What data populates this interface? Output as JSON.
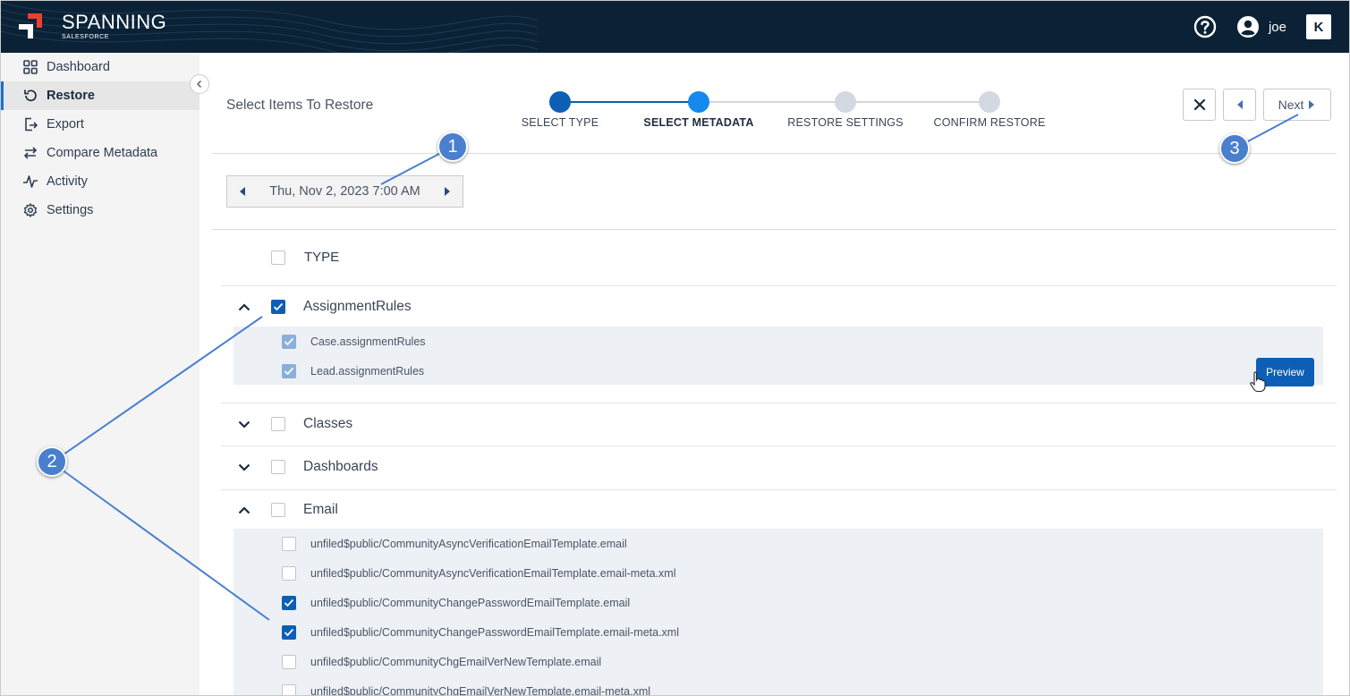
{
  "header": {
    "brand_title": "SPANNING",
    "brand_sub": "SALESFORCE",
    "user": "joe",
    "vendor_logo": "K",
    "colors": {
      "bar": "#0b2236",
      "accent": "#e8412f"
    }
  },
  "sidebar": {
    "items": [
      {
        "label": "Dashboard",
        "icon": "grid-icon"
      },
      {
        "label": "Restore",
        "icon": "restore-icon",
        "active": true
      },
      {
        "label": "Export",
        "icon": "export-icon"
      },
      {
        "label": "Compare Metadata",
        "icon": "compare-icon"
      },
      {
        "label": "Activity",
        "icon": "activity-icon"
      },
      {
        "label": "Settings",
        "icon": "gear-icon"
      }
    ]
  },
  "main": {
    "title": "Select Items To Restore",
    "steps": [
      {
        "label": "SELECT TYPE",
        "state": "done"
      },
      {
        "label": "SELECT METADATA",
        "state": "current"
      },
      {
        "label": "RESTORE SETTINGS",
        "state": "todo"
      },
      {
        "label": "CONFIRM RESTORE",
        "state": "todo"
      }
    ],
    "next_label": "Next",
    "date": "Thu, Nov 2, 2023 7:00 AM",
    "type_header": "TYPE",
    "groups": [
      {
        "name": "AssignmentRules",
        "expanded": true,
        "checked": true,
        "items": [
          {
            "name": "Case.assignmentRules",
            "checked": true
          },
          {
            "name": "Lead.assignmentRules",
            "checked": true
          }
        ],
        "preview_label": "Preview"
      },
      {
        "name": "Classes",
        "expanded": false,
        "checked": false
      },
      {
        "name": "Dashboards",
        "expanded": false,
        "checked": false
      },
      {
        "name": "Email",
        "expanded": true,
        "checked": false,
        "items": [
          {
            "name": "unfiled$public/CommunityAsyncVerificationEmailTemplate.email",
            "checked": false
          },
          {
            "name": "unfiled$public/CommunityAsyncVerificationEmailTemplate.email-meta.xml",
            "checked": false
          },
          {
            "name": "unfiled$public/CommunityChangePasswordEmailTemplate.email",
            "checked": true
          },
          {
            "name": "unfiled$public/CommunityChangePasswordEmailTemplate.email-meta.xml",
            "checked": true
          },
          {
            "name": "unfiled$public/CommunityChgEmailVerNewTemplate.email",
            "checked": false
          },
          {
            "name": "unfiled$public/CommunityChgEmailVerNewTemplate.email-meta.xml",
            "checked": false
          }
        ]
      }
    ]
  },
  "annotations": [
    "1",
    "2",
    "3"
  ]
}
